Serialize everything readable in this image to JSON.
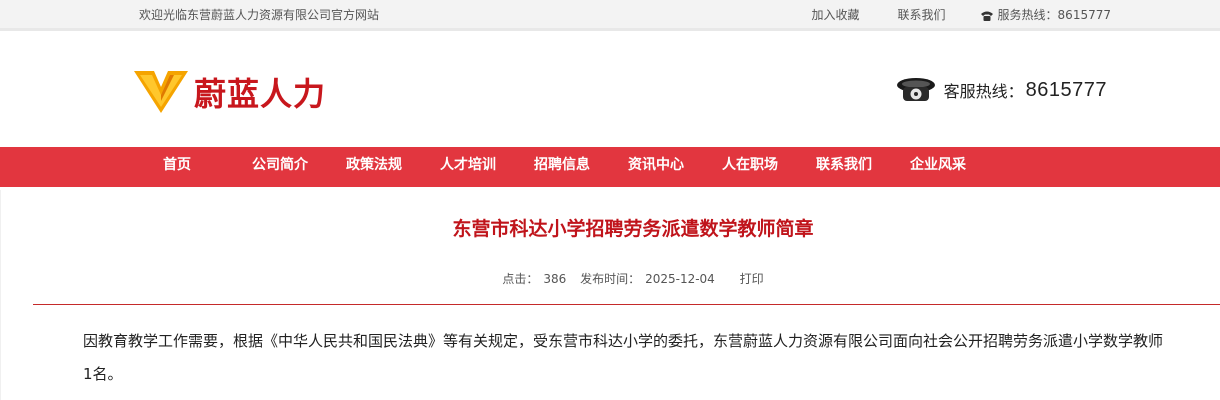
{
  "topbar": {
    "welcome": "欢迎光临东营蔚蓝人力资源有限公司官方网站",
    "add_favorite": "加入收藏",
    "contact_us": "联系我们",
    "hotline": "服务热线：8615777"
  },
  "header": {
    "logo_text": "蔚蓝人力",
    "service_label": "客服热线：",
    "service_number": "8615777"
  },
  "nav": {
    "items": [
      "首页",
      "公司简介",
      "政策法规",
      "人才培训",
      "招聘信息",
      "资讯中心",
      "人在职场",
      "联系我们",
      "企业风采"
    ]
  },
  "article": {
    "title": "东营市科达小学招聘劳务派遣数学教师简章",
    "hits_label": "点击：",
    "hits": "386",
    "date_label": "发布时间：",
    "date": "2025-12-04",
    "print": "打印",
    "paragraph_line1": "因教育教学工作需要，根据《中华人民共和国民法典》等有关规定，受东营市科达小学的委托，东营蔚蓝人力资源有限公司面向社会公开招聘劳务派遣小学数学教师",
    "paragraph_line2": "1名。"
  },
  "colors": {
    "nav_bg": "#e2363f",
    "title_red": "#c0141b",
    "logo_red": "#c8171d",
    "logo_gold": "#f5a400"
  }
}
